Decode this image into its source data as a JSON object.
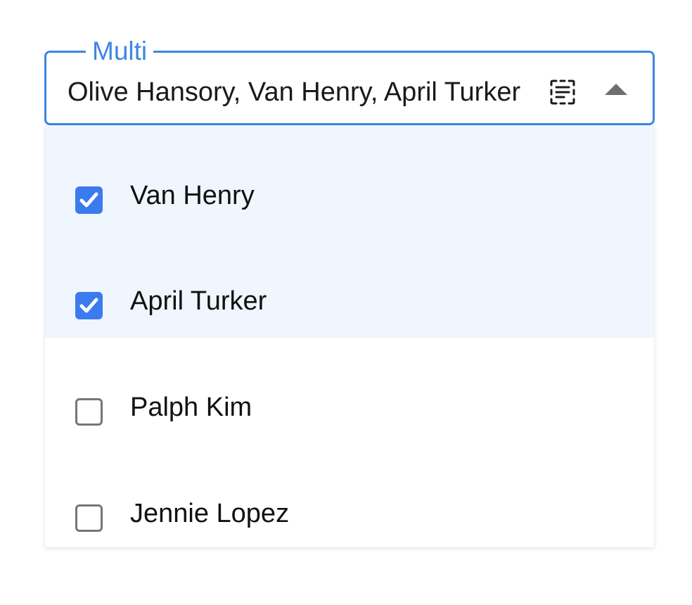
{
  "select": {
    "label": "Multi",
    "value": "Olive Hansory, Van Henry, April Turker",
    "scan_icon": "text-scan-icon",
    "toggle_icon": "caret-up-icon",
    "accent_color": "#3e86e3"
  },
  "options": [
    {
      "label": "Van Henry",
      "checked": true
    },
    {
      "label": "April Turker",
      "checked": true
    },
    {
      "label": "Palph Kim",
      "checked": false
    },
    {
      "label": "Jennie Lopez",
      "checked": false
    }
  ],
  "colors": {
    "selected_bg": "#eff6fd",
    "checkbox_checked": "#3b7bed",
    "checkbox_unchecked_border": "#767676"
  }
}
